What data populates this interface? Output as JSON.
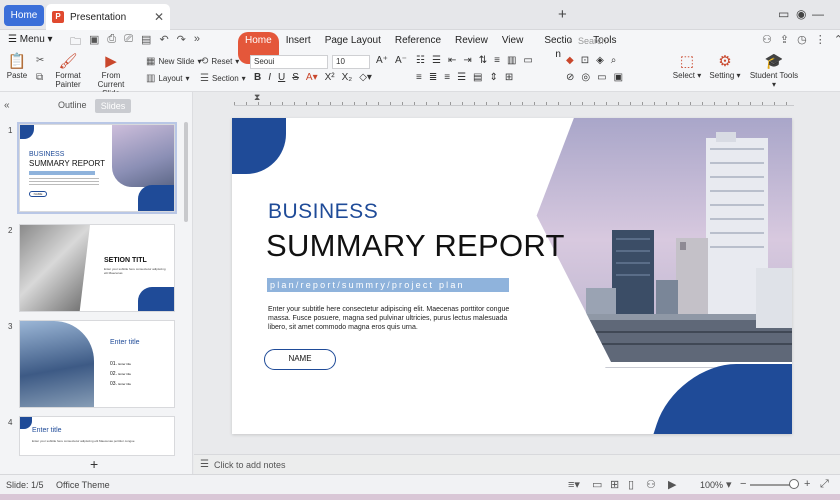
{
  "tabs": {
    "home": "Home",
    "document": "Presentation"
  },
  "menu": {
    "label": "Menu",
    "items": [
      "Home",
      "Insert",
      "Page Layout",
      "Reference",
      "Review",
      "View",
      "Sectio",
      "Tools"
    ],
    "active": "Home",
    "section_wrap": "n"
  },
  "search": {
    "placeholder": "Search"
  },
  "toolbar": {
    "paste": "Paste",
    "format_painter_1": "Format",
    "format_painter_2": "Painter",
    "from_current_1": "From Current",
    "from_current_2": "Slide",
    "new_slide": "New Slide",
    "layout": "Layout",
    "reset": "Reset",
    "section": "Section",
    "font_name": "Seoui",
    "font_size": "10",
    "select": "Select",
    "setting": "Setting",
    "student_tools": "Student Tools"
  },
  "panel": {
    "outline": "Outline",
    "slides": "Slides"
  },
  "thumbnails": [
    {
      "num": "1",
      "line1": "BUSINESS",
      "line2": "SUMMARY REPORT",
      "button": "NAME"
    },
    {
      "num": "2",
      "title": "SETION TITL",
      "sub": "Enter your subtitle here consectetur adipiscing elit Maecenas"
    },
    {
      "num": "3",
      "title": "Enter title",
      "items": [
        "01.",
        "02.",
        "03."
      ],
      "item_text": "Enter title"
    },
    {
      "num": "4",
      "title": "Enter title",
      "sub": "Enter your subtitle here consectetur adipiscing elit Maecenas porttitor congue"
    }
  ],
  "slide": {
    "line1": "BUSINESS",
    "line2": "SUMMARY REPORT",
    "tagline": "plan/report/summry/project plan",
    "body": "Enter your subtitle here consectetur adipiscing elit. Maecenas porttitor congue massa. Fusce posuere, magna sed pulvinar ultricies, purus lectus malesuada libero, sit amet commodo magna eros quis urna.",
    "button": "NAME"
  },
  "notes": {
    "placeholder": "Click to add notes"
  },
  "status": {
    "slide": "Slide: 1/5",
    "theme": "Office Theme",
    "zoom": "100%"
  },
  "colors": {
    "accent": "#e4573a",
    "brand_blue": "#1f4b98",
    "tab_blue": "#3b6fd9",
    "tag_blue": "#8fb3dc"
  }
}
